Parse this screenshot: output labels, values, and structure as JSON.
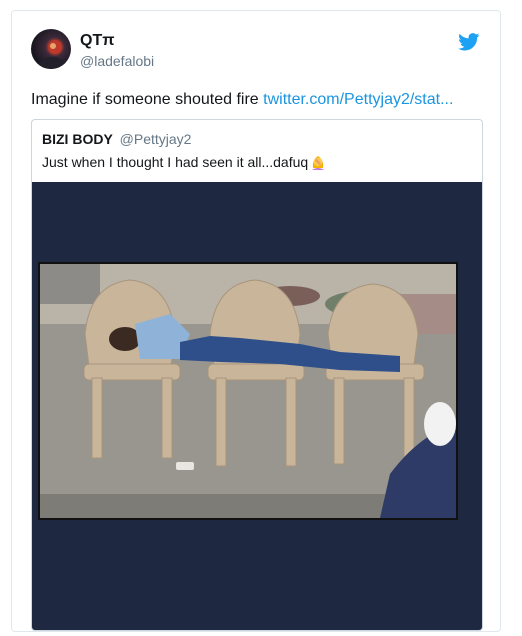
{
  "tweet": {
    "author_name": "QTπ",
    "author_handle": "@ladefalobi",
    "text": "Imagine if someone shouted fire ",
    "link_text": "twitter.com/Pettyjay2/stat..."
  },
  "quoted_tweet": {
    "author_name": "BIZI BODY",
    "author_handle": "@Pettyjay2",
    "text": "Just when I thought I had seen it all...dafuq"
  },
  "icons": {
    "platform": "twitter-bird-icon",
    "emoji": "woman-facepalming-emoji-icon"
  },
  "colors": {
    "link": "#1b95e0",
    "twitter_blue": "#1da1f2",
    "media_background": "#1e2841",
    "secondary_text": "#657786"
  }
}
